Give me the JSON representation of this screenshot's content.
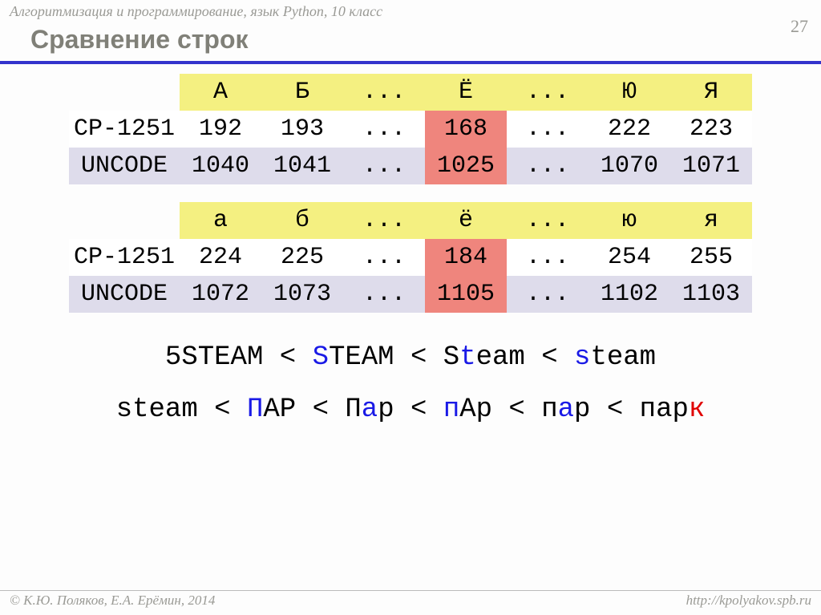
{
  "header": "Алгоритмизация и программирование, язык Python, 10 класс",
  "page_number": "27",
  "title": "Сравнение строк",
  "tables": [
    {
      "header": [
        "",
        "А",
        "Б",
        "...",
        "Ё",
        "...",
        "Ю",
        "Я"
      ],
      "rows": [
        {
          "label": "CP-1251",
          "cells": [
            "192",
            "193",
            "...",
            "168",
            "...",
            "222",
            "223"
          ],
          "highlight_index": 3
        },
        {
          "label": "UNCODE",
          "cells": [
            "1040",
            "1041",
            "...",
            "1025",
            "...",
            "1070",
            "1071"
          ],
          "highlight_index": 3
        }
      ]
    },
    {
      "header": [
        "",
        "а",
        "б",
        "...",
        "ё",
        "...",
        "ю",
        "я"
      ],
      "rows": [
        {
          "label": "CP-1251",
          "cells": [
            "224",
            "225",
            "...",
            "184",
            "...",
            "254",
            "255"
          ],
          "highlight_index": 3
        },
        {
          "label": "UNCODE",
          "cells": [
            "1072",
            "1073",
            "...",
            "1105",
            "...",
            "1102",
            "1103"
          ],
          "highlight_index": 3
        }
      ]
    }
  ],
  "chart_data": [
    {
      "type": "table",
      "title": "Uppercase Cyrillic letter codes",
      "columns": [
        "А",
        "Б",
        "...",
        "Ё",
        "...",
        "Ю",
        "Я"
      ],
      "series": [
        {
          "name": "CP-1251",
          "values": [
            192,
            193,
            null,
            168,
            null,
            222,
            223
          ]
        },
        {
          "name": "UNCODE",
          "values": [
            1040,
            1041,
            null,
            1025,
            null,
            1070,
            1071
          ]
        }
      ]
    },
    {
      "type": "table",
      "title": "Lowercase Cyrillic letter codes",
      "columns": [
        "а",
        "б",
        "...",
        "ё",
        "...",
        "ю",
        "я"
      ],
      "series": [
        {
          "name": "CP-1251",
          "values": [
            224,
            225,
            null,
            184,
            null,
            254,
            255
          ]
        },
        {
          "name": "UNCODE",
          "values": [
            1072,
            1073,
            null,
            1105,
            null,
            1102,
            1103
          ]
        }
      ]
    }
  ],
  "comparison_lines": [
    [
      {
        "t": "5STEAM < ",
        "c": "blk"
      },
      {
        "t": "S",
        "c": "blu"
      },
      {
        "t": "TEAM < S",
        "c": "blk"
      },
      {
        "t": "t",
        "c": "blu"
      },
      {
        "t": "eam < ",
        "c": "blk"
      },
      {
        "t": "s",
        "c": "blu"
      },
      {
        "t": "team",
        "c": "blk"
      }
    ],
    [
      {
        "t": "steam < ",
        "c": "blk"
      },
      {
        "t": "П",
        "c": "blu"
      },
      {
        "t": "АР < П",
        "c": "blk"
      },
      {
        "t": "а",
        "c": "blu"
      },
      {
        "t": "р < ",
        "c": "blk"
      },
      {
        "t": "п",
        "c": "blu"
      },
      {
        "t": "Ар < п",
        "c": "blk"
      },
      {
        "t": "а",
        "c": "blu"
      },
      {
        "t": "р < пар",
        "c": "blk"
      },
      {
        "t": "к",
        "c": "red"
      }
    ]
  ],
  "footer": {
    "left": "© К.Ю. Поляков, Е.А. Ерёмин, 2014",
    "right": "http://kpolyakov.spb.ru"
  }
}
